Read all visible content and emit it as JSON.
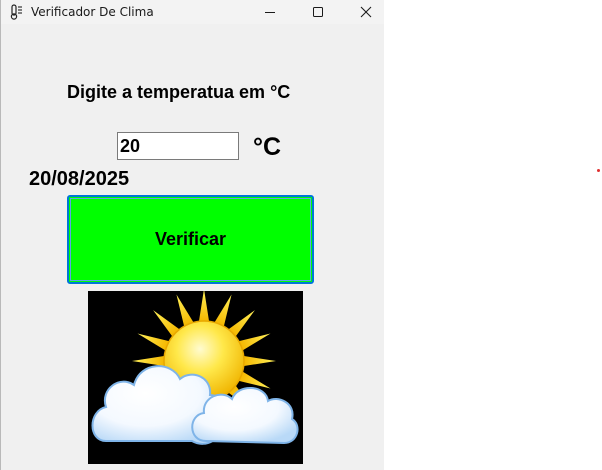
{
  "window": {
    "title": "Verificador De Clima",
    "controls": {
      "minimize": "minimize-icon",
      "maximize": "maximize-icon",
      "close": "close-icon"
    }
  },
  "form": {
    "prompt_label": "Digite a temperatua em °C",
    "temperature_value": "20",
    "unit_label": "°C",
    "date": "20/08/2025",
    "verify_button_label": "Verificar"
  },
  "image": {
    "icon": "sun-behind-clouds-icon"
  },
  "colors": {
    "button_bg": "#00ff00",
    "button_border": "#0078d7",
    "window_bg": "#f0f0f0",
    "image_bg": "#000000"
  }
}
